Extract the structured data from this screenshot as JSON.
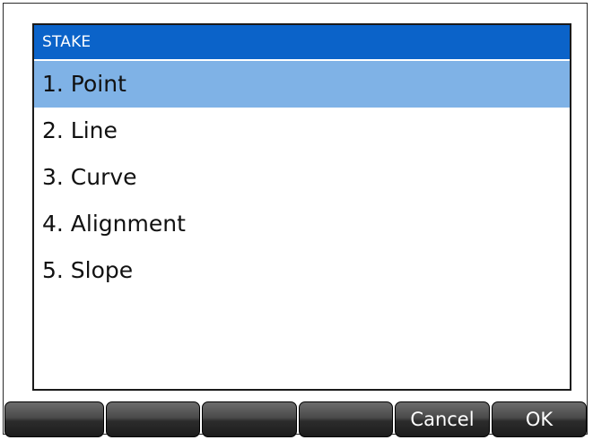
{
  "dialog": {
    "title": "STAKE",
    "items": [
      {
        "label": "1. Point",
        "selected": true
      },
      {
        "label": "2. Line",
        "selected": false
      },
      {
        "label": "3. Curve",
        "selected": false
      },
      {
        "label": "4. Alignment",
        "selected": false
      },
      {
        "label": "5. Slope",
        "selected": false
      }
    ]
  },
  "softkeys": [
    "",
    "",
    "",
    "",
    "Cancel",
    "OK"
  ],
  "colors": {
    "title_bar": "#0b63c9",
    "selected_row": "#7fb2e6",
    "softkey": "#2c2c2c"
  }
}
